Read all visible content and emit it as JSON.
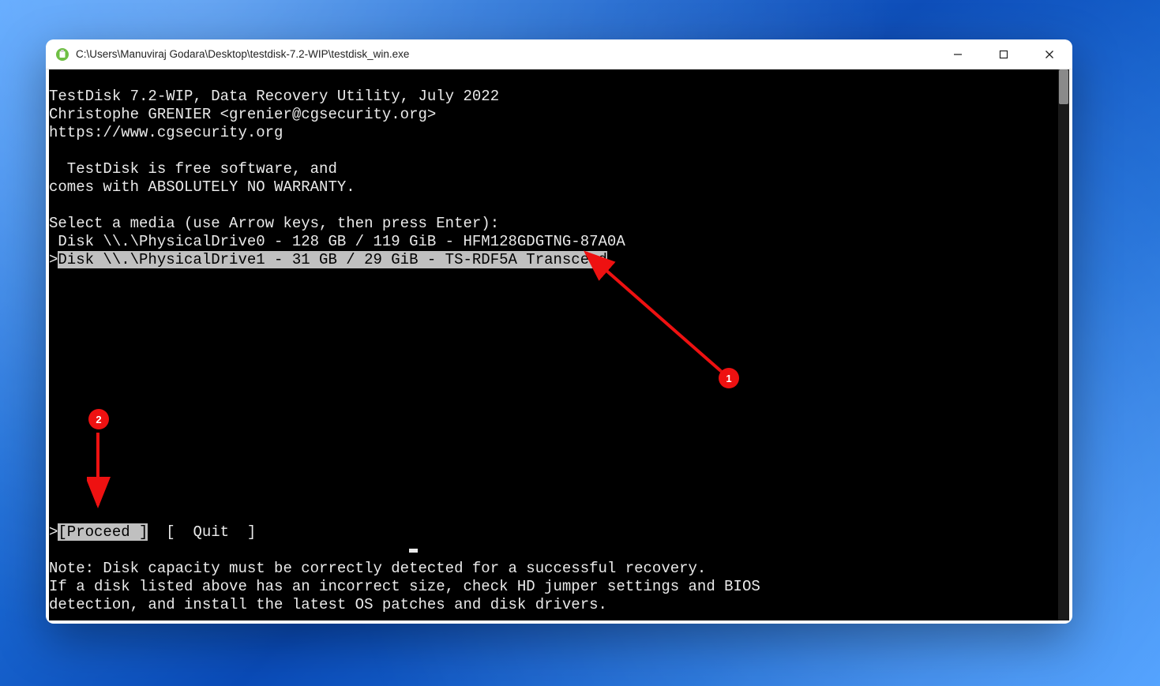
{
  "window": {
    "title": "C:\\Users\\Manuviraj Godara\\Desktop\\testdisk-7.2-WIP\\testdisk_win.exe"
  },
  "terminal": {
    "header_line1": "TestDisk 7.2-WIP, Data Recovery Utility, July 2022",
    "header_line2": "Christophe GRENIER <grenier@cgsecurity.org>",
    "header_line3": "https://www.cgsecurity.org",
    "free1": "  TestDisk is free software, and",
    "free2": "comes with ABSOLUTELY NO WARRANTY.",
    "select_prompt": "Select a media (use Arrow keys, then press Enter):",
    "disk0": " Disk \\\\.\\PhysicalDrive0 - 128 GB / 119 GiB - HFM128GDGTNG-87A0A",
    "disk1_prefix": ">",
    "disk1_text": "Disk \\\\.\\PhysicalDrive1 - 31 GB / 29 GiB - TS-RDF5A Transcend",
    "action_prefix": ">",
    "action_proceed": "[Proceed ]",
    "action_quit_wrap_left": "  [  ",
    "action_quit": "Quit",
    "action_quit_wrap_right": "  ]",
    "note1": "Note: Disk capacity must be correctly detected for a successful recovery.",
    "note2": "If a disk listed above has an incorrect size, check HD jumper settings and BIOS",
    "note3": "detection, and install the latest OS patches and disk drivers."
  },
  "annotations": {
    "dot1": "1",
    "dot2": "2"
  }
}
